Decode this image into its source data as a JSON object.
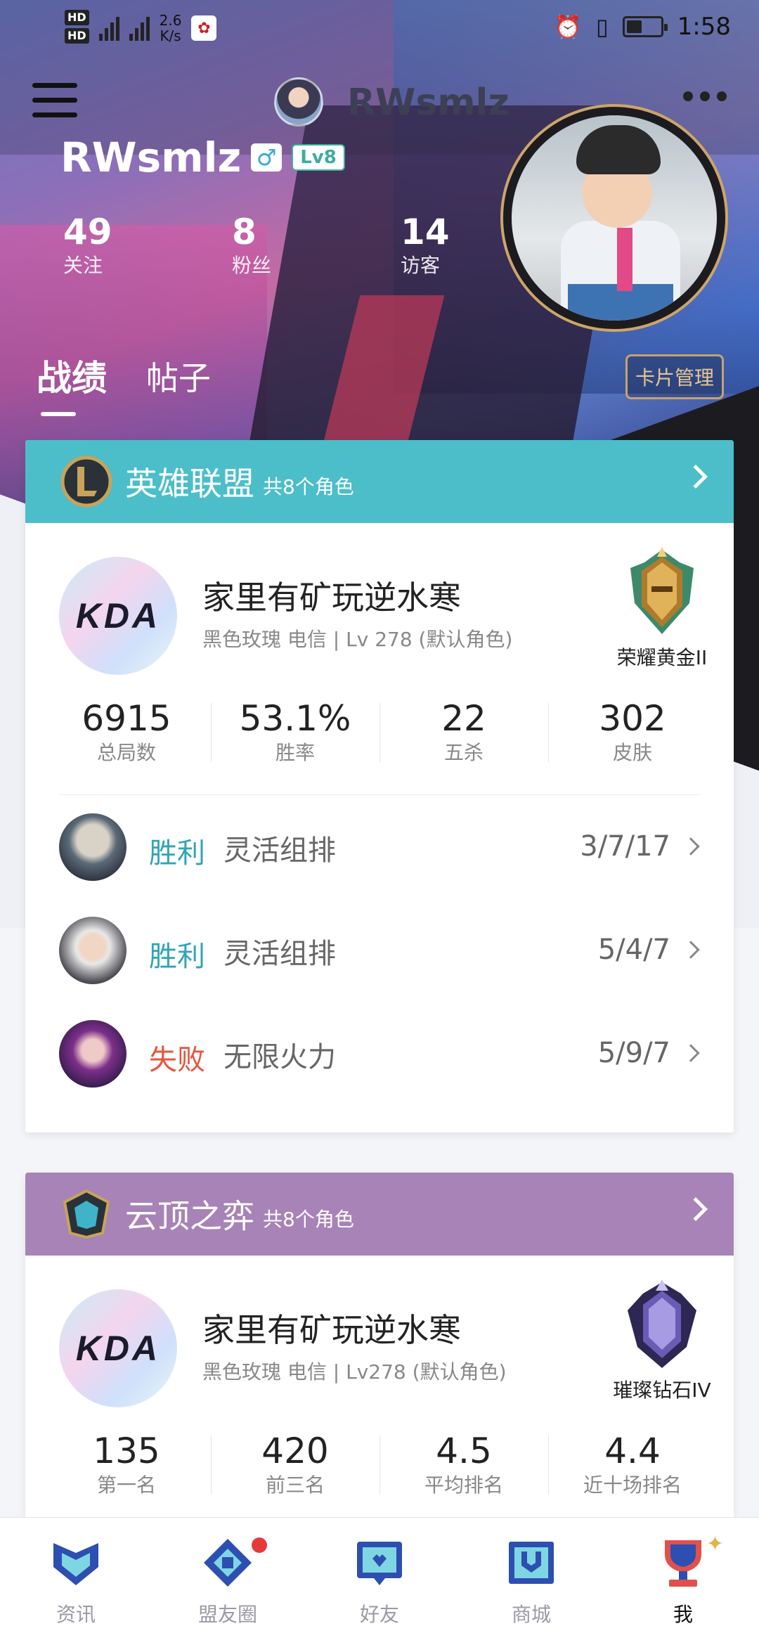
{
  "status_bar": {
    "net_speed_value": "2.6",
    "net_speed_unit": "K/s",
    "time": "1:58",
    "battery_level": 0.45,
    "icons": [
      "hd-icon",
      "signal-4g-icon",
      "signal-4g-icon",
      "app-notification-icon",
      "alarm-icon",
      "vibrate-icon",
      "battery-icon"
    ]
  },
  "toolbar": {
    "title": "RWsmlz"
  },
  "profile": {
    "username": "RWsmlz",
    "gender_symbol": "♂",
    "level": "Lv8",
    "stats": [
      {
        "value": "49",
        "label": "关注"
      },
      {
        "value": "8",
        "label": "粉丝"
      },
      {
        "value": "14",
        "label": "访客"
      }
    ]
  },
  "tabs": [
    {
      "label": "战绩",
      "active": true
    },
    {
      "label": "帖子",
      "active": false
    }
  ],
  "card_manage_label": "卡片管理",
  "games": [
    {
      "name": "英雄联盟",
      "sub": "共8个角色",
      "header_color": "#4bbec9",
      "role": {
        "avatar_text": "KDA",
        "name": "家里有矿玩逆水寒",
        "sub": "黑色玫瑰 电信 | Lv 278 (默认角色)",
        "rank": "荣耀黄金II"
      },
      "stats": [
        {
          "value": "6915",
          "label": "总局数"
        },
        {
          "value": "53.1%",
          "label": "胜率"
        },
        {
          "value": "22",
          "label": "五杀"
        },
        {
          "value": "302",
          "label": "皮肤"
        }
      ],
      "matches": [
        {
          "result": "胜利",
          "mode": "灵活组排",
          "kda": "3/7/17"
        },
        {
          "result": "胜利",
          "mode": "灵活组排",
          "kda": "5/4/7"
        },
        {
          "result": "失败",
          "mode": "无限火力",
          "kda": "5/9/7"
        }
      ]
    },
    {
      "name": "云顶之弈",
      "sub": "共8个角色",
      "header_color": "#a783b7",
      "role": {
        "avatar_text": "KDA",
        "name": "家里有矿玩逆水寒",
        "sub": "黑色玫瑰 电信 | Lv278 (默认角色)",
        "rank": "璀璨钻石IV"
      },
      "stats": [
        {
          "value": "135",
          "label": "第一名"
        },
        {
          "value": "420",
          "label": "前三名"
        },
        {
          "value": "4.5",
          "label": "平均排名"
        },
        {
          "value": "4.4",
          "label": "近十场排名"
        }
      ]
    }
  ],
  "bottom_nav": [
    {
      "label": "资讯",
      "icon": "news-icon",
      "active": false
    },
    {
      "label": "盟友圈",
      "icon": "friends-circle-icon",
      "active": false,
      "badge": true
    },
    {
      "label": "好友",
      "icon": "chat-icon",
      "active": false
    },
    {
      "label": "商城",
      "icon": "store-icon",
      "active": false
    },
    {
      "label": "我",
      "icon": "me-trophy-icon",
      "active": true
    }
  ],
  "colors": {
    "win": "#2fa4b7",
    "lose": "#e3573e",
    "gold_border": "#c9a26b"
  }
}
